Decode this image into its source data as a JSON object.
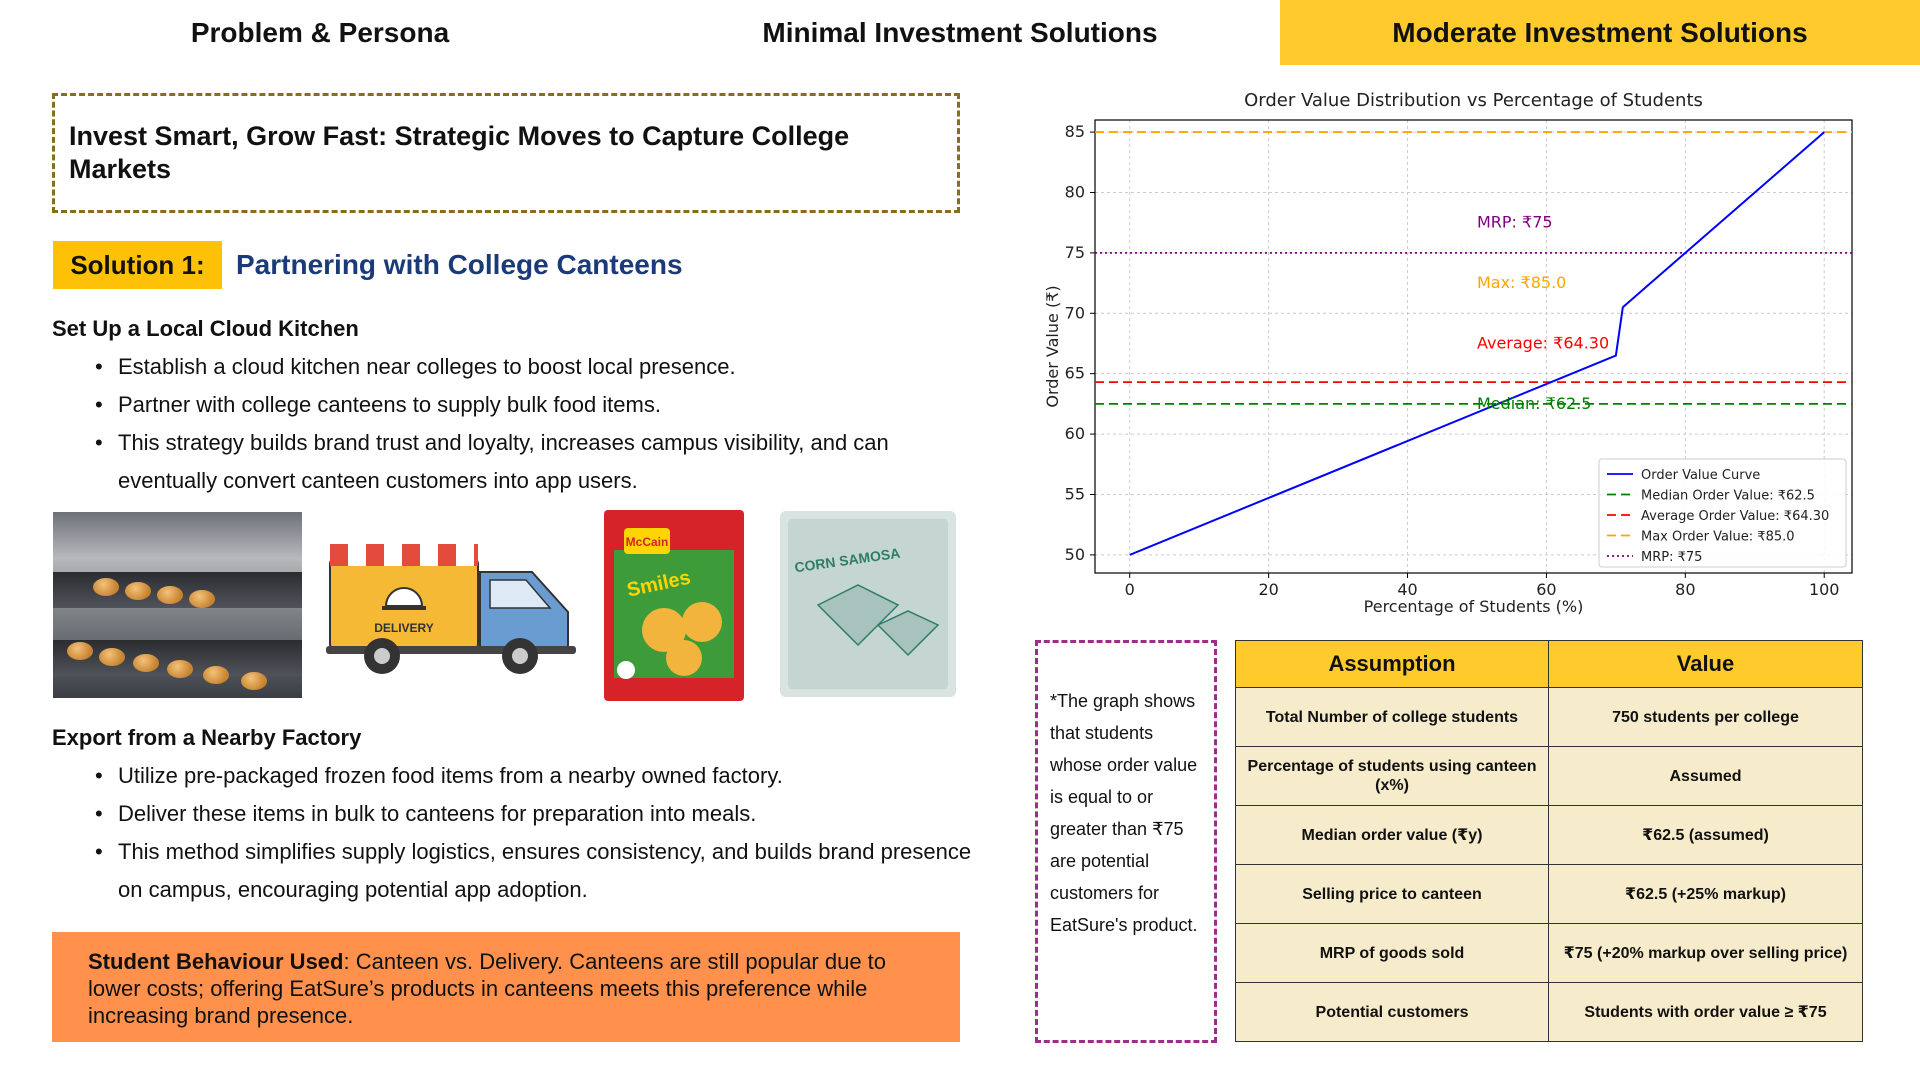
{
  "tabs": [
    {
      "label": "Problem & Persona"
    },
    {
      "label": "Minimal Investment Solutions"
    },
    {
      "label": "Moderate Investment Solutions"
    }
  ],
  "title": "Invest Smart, Grow Fast: Strategic Moves to Capture College Markets",
  "solution": {
    "badge": "Solution 1:",
    "title": "Partnering with College Canteens"
  },
  "sections": [
    {
      "heading": "Set Up a Local Cloud Kitchen",
      "bullets": [
        "Establish a cloud kitchen near colleges to boost local presence.",
        "Partner with college canteens to supply bulk food items.",
        "This strategy builds brand trust and loyalty, increases campus visibility, and can eventually convert canteen customers into app users."
      ]
    },
    {
      "heading": "Export from a Nearby Factory",
      "bullets": [
        "Utilize pre-packaged frozen food items from a nearby owned factory.",
        "Deliver these items in bulk to canteens for preparation into meals.",
        "This method simplifies supply logistics, ensures consistency, and builds brand presence on campus, encouraging potential app adoption."
      ]
    }
  ],
  "images": {
    "truck_label": "DELIVERY",
    "mccain_brand": "McCain",
    "mccain_product": "Smiles",
    "samosa_label": "CORN SAMOSA"
  },
  "behaviour": {
    "label": "Student Behaviour Used",
    "text": ": Canteen vs. Delivery. Canteens are still popular due to lower costs; offering EatSure’s products in canteens meets this preference while increasing brand presence."
  },
  "chart_data": {
    "type": "line",
    "title": "Order Value Distribution vs Percentage of Students",
    "xlabel": "Percentage of Students (%)",
    "ylabel": "Order Value (₹)",
    "xlim": [
      -5,
      104
    ],
    "ylim": [
      48.5,
      86
    ],
    "xticks": [
      0,
      20,
      40,
      60,
      80,
      100
    ],
    "yticks": [
      50,
      55,
      60,
      65,
      70,
      75,
      80,
      85
    ],
    "grid": true,
    "legend_position": "lower right",
    "series": [
      {
        "name": "Order Value Curve",
        "color": "#0000FF",
        "style": "solid",
        "x": [
          0,
          70,
          70.5,
          71,
          100
        ],
        "y": [
          50,
          66.5,
          68.5,
          70.5,
          85
        ]
      }
    ],
    "hlines": [
      {
        "name": "Median Order Value: ₹62.5",
        "y": 62.5,
        "color": "#008000",
        "style": "dashed",
        "annotation": "Median: ₹62.5"
      },
      {
        "name": "Average Order Value: ₹64.30",
        "y": 64.3,
        "color": "#FF0000",
        "style": "dashed",
        "annotation": "Average: ₹64.30"
      },
      {
        "name": "Max Order Value: ₹85.0",
        "y": 85.0,
        "color": "#FFA500",
        "style": "dashed",
        "annotation": "Max: ₹85.0"
      },
      {
        "name": "MRP: ₹75",
        "y": 75,
        "color": "#800080",
        "style": "dotted",
        "annotation": "MRP: ₹75"
      }
    ],
    "annotations_x": 50,
    "annotation_y": [
      62.5,
      67.5,
      72.5,
      77.5
    ]
  },
  "note": "*The graph shows that students whose order value is equal to or greater than ₹75 are potential customers for EatSure's product.",
  "table": {
    "headers": [
      "Assumption",
      "Value"
    ],
    "rows": [
      [
        "Total Number of college students",
        "750 students per college"
      ],
      [
        "Percentage of students using canteen (x%)",
        "Assumed"
      ],
      [
        "Median order value (₹y)",
        "₹62.5 (assumed)"
      ],
      [
        "Selling price to canteen",
        "₹62.5 (+25% markup)"
      ],
      [
        "MRP of goods sold",
        "₹75 (+20% markup over selling price)"
      ],
      [
        "Potential customers",
        "Students with order value ≥ ₹75"
      ]
    ]
  },
  "colors": {
    "accent": "#FFCA2C",
    "badge": "#FFC107",
    "solution_title": "#1A3A7A",
    "behaviour_bg": "#FF914D",
    "table_cell": "#F6EBCB",
    "note_border": "#9B2D8F"
  }
}
